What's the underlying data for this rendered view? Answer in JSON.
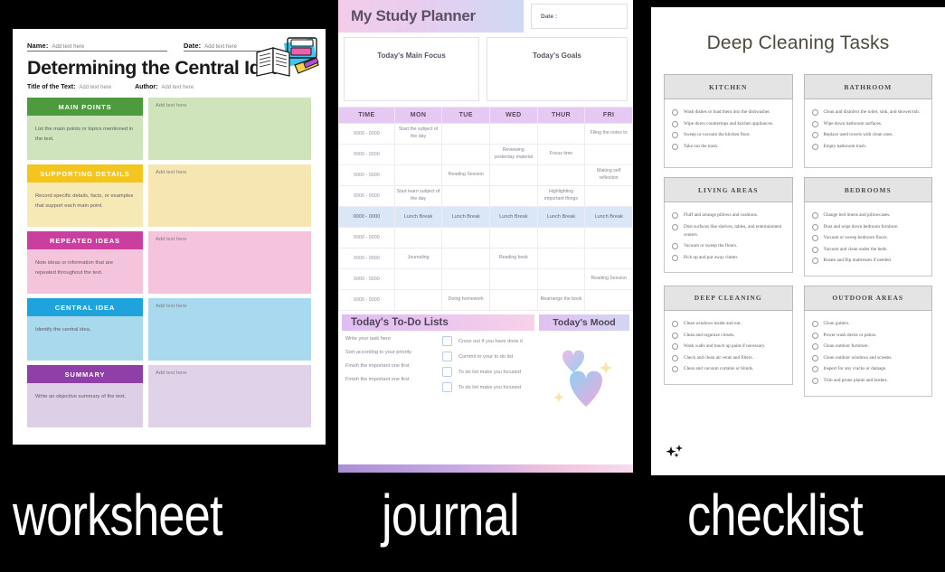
{
  "captions": {
    "worksheet": "worksheet",
    "journal": "journal",
    "checklist": "checklist"
  },
  "worksheet": {
    "name_label": "Name:",
    "name_value": "Add text here",
    "date_label": "Date:",
    "date_value": "Add text here",
    "title": "Determining the Central Idea",
    "text_title_label": "Title of the Text:",
    "text_title_value": "Add text here",
    "author_label": "Author:",
    "author_value": "Add text here",
    "book_icon": "open-book-icon",
    "placeholder": "Add text here",
    "rows": [
      {
        "caption": "MAIN POINTS",
        "hint": "List the main points or topics mentioned in the text.",
        "answer": "Add text here",
        "cap_color": "#4e9b3f",
        "body_color": "#cfe3bc",
        "panel_color": "#cfe4bb"
      },
      {
        "caption": "SUPPORTING DETAILS",
        "hint": "Record specific details, facts, or examples that support each main point.",
        "answer": "Add text here",
        "cap_color": "#f5c51f",
        "body_color": "#f7e9b6",
        "panel_color": "#f6e7b2"
      },
      {
        "caption": "REPEATED IDEAS",
        "hint": "Note ideas or information that are repeated throughout the text.",
        "answer": "Add text here",
        "cap_color": "#ca3f9e",
        "body_color": "#f4c4dc",
        "panel_color": "#f5c3dc"
      },
      {
        "caption": "CENTRAL IDEA",
        "hint": "Identify the central idea.",
        "answer": "Add text here",
        "cap_color": "#1fa3dc",
        "body_color": "#a9d9ec",
        "panel_color": "#a8d9ee"
      },
      {
        "caption": "SUMMARY",
        "hint": "Write an objective summary of the text.",
        "answer": "Add text here",
        "cap_color": "#8f3fa8",
        "body_color": "#ddcfe6",
        "panel_color": "#e0d2e8"
      }
    ]
  },
  "journal": {
    "title": "My Study Planner",
    "date_label": "Date :",
    "main_focus_label": "Today's Main Focus",
    "goals_label": "Today's Goals",
    "table": {
      "headers": [
        "TIME",
        "MON",
        "TUE",
        "WED",
        "THUR",
        "FRI"
      ],
      "rows": [
        {
          "time": "0000 - 0000",
          "cells": [
            "Start the subject of the day",
            "",
            "",
            "",
            "Filing the notes to"
          ]
        },
        {
          "time": "0000 - 0000",
          "cells": [
            "",
            "",
            "Reviewing yesterday material",
            "Focus time",
            ""
          ]
        },
        {
          "time": "0000 - 0000",
          "cells": [
            "",
            "Reading Session",
            "",
            "",
            "Making self reflection"
          ]
        },
        {
          "time": "0000 - 0000",
          "cells": [
            "Start learn subject of the day",
            "",
            "",
            "Highlighting important things",
            ""
          ]
        },
        {
          "time": "0000 - 0000",
          "cells": [
            "Lunch Break",
            "Lunch Break",
            "Lunch Break",
            "Lunch Break",
            "Lunch Break"
          ],
          "lunch": true
        },
        {
          "time": "0000 - 0000",
          "cells": [
            "",
            "",
            "",
            "",
            ""
          ]
        },
        {
          "time": "0000 - 0000",
          "cells": [
            "Journaling",
            "",
            "Reading book",
            "",
            ""
          ]
        },
        {
          "time": "0000 - 0000",
          "cells": [
            "",
            "",
            "",
            "",
            "Reading Session"
          ]
        },
        {
          "time": "0000 - 0000",
          "cells": [
            "",
            "Doing homework",
            "",
            "Rearrange the book",
            ""
          ]
        }
      ]
    },
    "todo_header": "Today's To-Do Lists",
    "mood_header": "Today's Mood",
    "todo_left": [
      "Write your task here",
      "Sort according to your priority",
      "Finish the important one first",
      "Finish the important one first"
    ],
    "todo_right": [
      "Cross out if you have done it",
      "Commit to your to do list",
      "To do list make you focused",
      "To do list make you focused"
    ],
    "mood_icon": "hearts-icon"
  },
  "checklist": {
    "title": "Deep Cleaning Tasks",
    "sparkle_icon": "sparkle-icon",
    "sections": [
      {
        "header": "KITCHEN",
        "items": [
          "Wash dishes or load them into the dishwasher.",
          "Wipe down countertops and kitchen appliances.",
          "Sweep or vacuum the kitchen floor.",
          "Take out the trash."
        ]
      },
      {
        "header": "BATHROOM",
        "items": [
          "Clean and disinfect the toilet, sink, and shower/tub.",
          "Wipe down bathroom surfaces.",
          "Replace used towels with clean ones.",
          "Empty bathroom trash."
        ]
      },
      {
        "header": "LIVING AREAS",
        "items": [
          "Fluff and arrange pillows and cushions.",
          "Dust surfaces like shelves, tables, and entertainment centers.",
          "Vacuum or sweep the floors.",
          "Pick up and put away clutter."
        ]
      },
      {
        "header": "BEDROOMS",
        "items": [
          "Change bed linens and pillowcases.",
          "Dust and wipe down bedroom furniture.",
          "Vacuum or sweep bedroom floors.",
          "Vacuum and clean under the beds.",
          "Rotate and flip mattresses if needed."
        ]
      },
      {
        "header": "DEEP CLEANING",
        "items": [
          "Clean windows inside and out.",
          "Clean and organize closets.",
          "Wash walls and touch up paint if necessary.",
          "Check and clean air vents and filters.",
          "Clean and vacuum curtains or blinds."
        ]
      },
      {
        "header": "OUTDOOR AREAS",
        "items": [
          "Clean gutters.",
          "Power wash decks or patios.",
          "Clean outdoor furniture.",
          "Clean outdoor windows and screens.",
          "Inspect for any cracks or damage.",
          "Trim and prune plants and bushes."
        ]
      }
    ]
  }
}
